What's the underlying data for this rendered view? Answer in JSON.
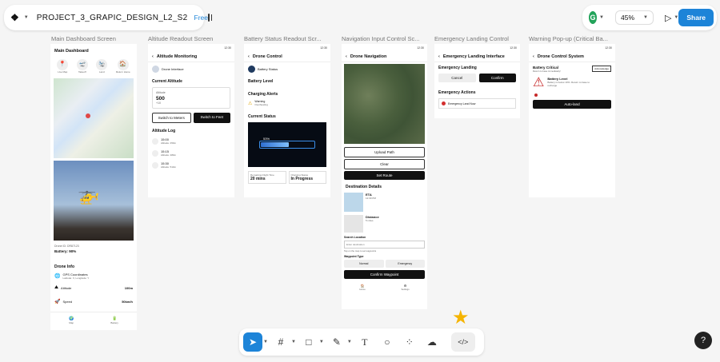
{
  "file": {
    "name": "PROJECT_3_GRAPIC_DESIGN_L2_S2",
    "plan": "Free"
  },
  "toolbar_right": {
    "avatar_letter": "G",
    "zoom": "45%",
    "share_label": "Share"
  },
  "frames": [
    {
      "title": "Main Dashboard Screen"
    },
    {
      "title": "Altitude Readout Screen"
    },
    {
      "title": "Battery Status Readout Scr..."
    },
    {
      "title": "Navigation Input Control Sc..."
    },
    {
      "title": "Emergency Landing Control"
    },
    {
      "title": "Warning Pop-up (Critical Ba..."
    }
  ],
  "status_time": "12:30",
  "dash": {
    "title": "Main Dashboard",
    "quick": [
      "Live Map",
      "Takeoff",
      "Land",
      "Return Home"
    ],
    "drone_id": "Drone ID: DR87123",
    "battery": "Battery: 90%",
    "info_title": "Drone Info",
    "gps_label": "GPS Coordinates",
    "gps_value": "Latitude: X, Longitude: Y",
    "altitude_label": "Altitude",
    "altitude_value": "100m",
    "speed_label": "Speed",
    "speed_value": "50km/h",
    "nav": [
      "Map",
      "Battery"
    ]
  },
  "alt": {
    "title": "Altitude Monitoring",
    "iface": "Drone Interface",
    "current": "Current Altitude",
    "card_label": "Altitude",
    "value": "500",
    "delta": "+10",
    "btn_meters": "Switch to Meters",
    "btn_feet": "Switch to Feet",
    "log_title": "Altitude Log",
    "log": [
      {
        "time": "15:00",
        "alt": "Altitude: 450m"
      },
      {
        "time": "15:15",
        "alt": "Altitude: 480m"
      },
      {
        "time": "15:30",
        "alt": "Altitude: 510m"
      }
    ]
  },
  "bat": {
    "title": "Drone Control",
    "status": "Battery Status",
    "level": "Battery Level",
    "alerts": "Charging Alerts",
    "warn": "Warning",
    "warn_sub": "Overheating",
    "current": "Current Status",
    "pct": "53%",
    "pct_value": 0.53,
    "remain_label": "Remaining Flight Time",
    "remain_value": "20 mins",
    "charge_label": "Charging Status",
    "charge_value": "In Progress"
  },
  "nav": {
    "title": "Drone Navigation",
    "upload": "Upload Path",
    "clear": "Clear",
    "set": "Set Route",
    "dest": "Destination Details",
    "eta_label": "ETA",
    "eta_value": "12:30 PM",
    "dist_label": "Distance",
    "dist_value": "5 miles",
    "search_label": "Search Location",
    "search_placeholder": "Enter destination",
    "search_hint": "Tap on the map to set waypoints",
    "wp_label": "Waypoint Type",
    "wp_normal": "Normal",
    "wp_emergency": "Emergency",
    "confirm": "Confirm Waypoint",
    "tabs": [
      "Home",
      "Settings"
    ]
  },
  "emg": {
    "title": "Emergency Landing Interface",
    "section": "Emergency Landing",
    "cancel": "Cancel",
    "confirm": "Confirm",
    "actions": "Emergency Actions",
    "land_now": "Emergency Land Now"
  },
  "warn": {
    "title": "Drone Control System",
    "critical": "Battery Critical",
    "critical_sub": "Return to base immediately!",
    "ack": "Acknowledge",
    "level": "Battery Level",
    "msg": "Battery is below 10%. Return to base to recharge",
    "autoland": "Auto-land"
  }
}
